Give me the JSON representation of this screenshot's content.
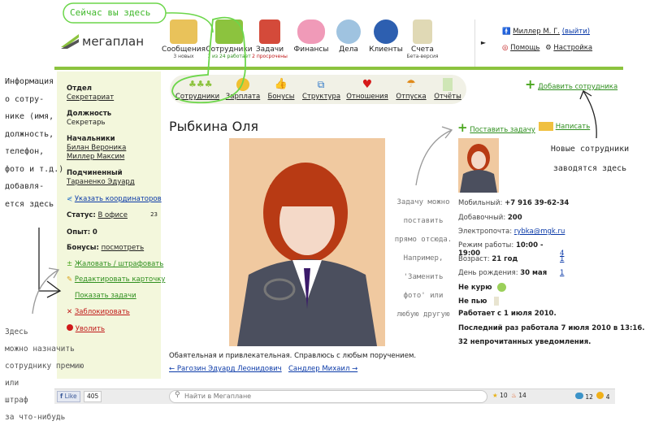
{
  "annotations": {
    "here_now": "Сейчас вы здесь",
    "left_info": [
      "Информация",
      "о сотру-",
      "нике (имя,",
      "должность,",
      "телефон,",
      "фото и т.д.)",
      "добавля-",
      "ется здесь"
    ],
    "task_note": [
      "Задачу можно",
      "поставить",
      "прямо отсюда.",
      "Например,",
      "'Заменить",
      "фото' или",
      "любую другую"
    ],
    "new_emp": [
      "Новые сотрудники",
      "заводятся здесь"
    ],
    "bonus_note": [
      "Здесь",
      "можно назначить",
      "сотруднику премию",
      "или",
      "штраф",
      "за что-нибудь"
    ]
  },
  "logo": {
    "text": "мегаплан"
  },
  "nav": [
    {
      "label": "Сообщения",
      "sub": "3 новых",
      "color": "#e9c25a"
    },
    {
      "label": "Сотрудники",
      "sub": "1 из 24 работает",
      "color": "#8cc33e"
    },
    {
      "label": "Задачи",
      "sub": "2 просрочены",
      "color": "#d44a3a"
    },
    {
      "label": "Финансы",
      "sub": "",
      "color": "#f09ab8"
    },
    {
      "label": "Дела",
      "sub": "",
      "color": "#9fc3e0"
    },
    {
      "label": "Клиенты",
      "sub": "",
      "color": "#2d5fb0"
    },
    {
      "label": "Счета",
      "sub": "Бета-версия",
      "color": "#e0d9b5"
    }
  ],
  "user": {
    "name": "Миллер М. Г.",
    "logout": "(выйти)",
    "help": "Помощь",
    "settings": "Настройка"
  },
  "subnav": [
    "Сотрудники",
    "Зарплата",
    "Бонусы",
    "Структура",
    "Отношения",
    "Отпуска",
    "Отчёты"
  ],
  "add_employee": "Добавить сотрудника",
  "left": {
    "dept_label": "Отдел",
    "dept": "Секретариат",
    "position_label": "Должность",
    "position": "Секретарь",
    "bosses_label": "Начальники",
    "bosses": [
      "Билан Вероника",
      "Миллер Максим"
    ],
    "subordinate_label": "Подчиненный",
    "subordinate": "Тараненко Эдуард",
    "coords": "Указать координаторов",
    "status_label": "Статус:",
    "status": "В офисе",
    "status_count": "23",
    "exp_label": "Опыт:",
    "exp": "0",
    "bonus_label": "Бонусы:",
    "bonus": "посмотреть",
    "complain": "Жаловать / штрафовать",
    "edit_card": "Редактировать карточку",
    "show_tasks": "Показать задачи",
    "block": "Заблокировать",
    "fire": "Уволить"
  },
  "profile": {
    "name": "Рыбкина Оля",
    "set_task": "Поставить задачу",
    "write": "Написать",
    "description": "Обаятельная и привлекательная. Справлюсь с любым поручением.",
    "prev": "← Рагозин Эдуард Леонидович",
    "next": "Сандлер Михаил →"
  },
  "info": {
    "mobile_label": "Мобильный:",
    "mobile": "+7 916 39-62-34",
    "ext_label": "Добавочный:",
    "ext": "200",
    "email_label": "Электропочта:",
    "email": "rybka@mgk.ru",
    "hours_label": "Режим работы:",
    "hours": "10:00 - 19:00",
    "hours_n": "4",
    "age_label": "Возраст:",
    "age": "21 год",
    "age_n": "1",
    "bday_label": "День рождения:",
    "bday": "30 мая",
    "bday_n": "1",
    "smoke": "Не курю",
    "drink": "Не пью",
    "since": "Работает с 1 июля 2010.",
    "last": "Последний раз работала 7 июля 2010 в 13:16.",
    "unread": "32 непрочитанных уведомления."
  },
  "bottom": {
    "like": "Like",
    "like_count": "405",
    "search_placeholder": "Найти в Мегаплане",
    "star_count": "10",
    "fire_count": "14",
    "bubble_count": "12",
    "warn_count": "4"
  }
}
